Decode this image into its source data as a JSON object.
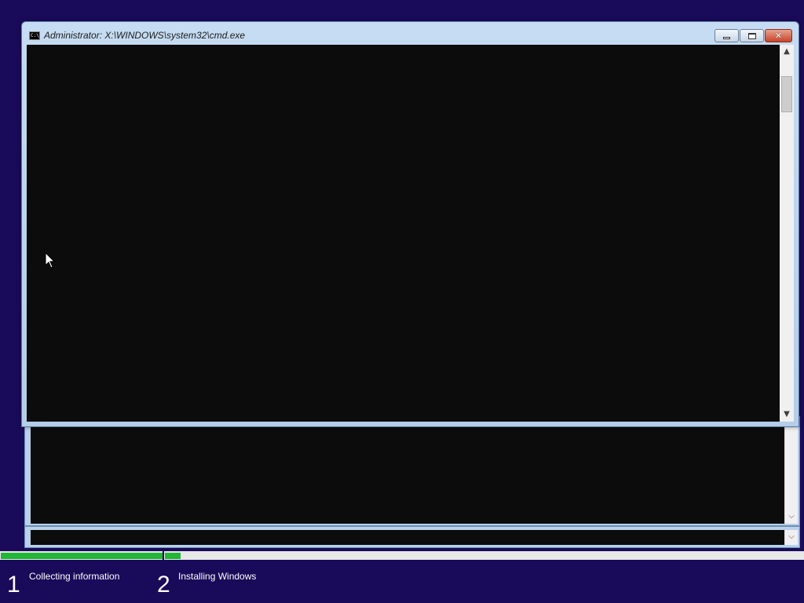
{
  "window": {
    "title": "Administrator: X:\\WINDOWS\\system32\\cmd.exe",
    "icon_text": "C:\\"
  },
  "steps": [
    {
      "number": "1",
      "label": "Collecting information"
    },
    {
      "number": "2",
      "label": "Installing Windows"
    }
  ],
  "progress": {
    "step1_fraction": 1.0,
    "step2_fraction": 0.025
  },
  "colors": {
    "background": "#1a0a5a",
    "progress_fill": "#21b636",
    "console": "#0c0c0c"
  }
}
